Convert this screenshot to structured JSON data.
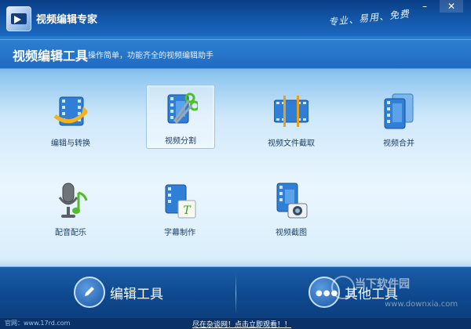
{
  "window": {
    "app_title": "视频编辑专家",
    "slogan": "专业、易用、免费",
    "min_glyph": "–",
    "close_glyph": "✕"
  },
  "header": {
    "title": "视频编辑工具",
    "description": "操作简单，功能齐全的视频编辑助手"
  },
  "tools": [
    {
      "label": "编辑与转换",
      "icon": "film-convert-icon"
    },
    {
      "label": "视频分割",
      "icon": "film-scissors-icon",
      "selected": true
    },
    {
      "label": "视频文件截取",
      "icon": "film-clip-icon"
    },
    {
      "label": "视频合并",
      "icon": "film-merge-icon"
    },
    {
      "label": "配音配乐",
      "icon": "microphone-music-icon"
    },
    {
      "label": "字幕制作",
      "icon": "film-subtitle-icon"
    },
    {
      "label": "视频截图",
      "icon": "film-camera-icon"
    }
  ],
  "bottom": {
    "edit_tools_label": "编辑工具",
    "other_tools_label": "其他工具"
  },
  "status": {
    "site": "官网：www.17rd.com",
    "promo": "尽在杂谈网！点击立即观看！！"
  },
  "watermark": {
    "brand": "当下软件园",
    "url": "www.downxia.com"
  },
  "colors": {
    "accent": "#1e6cc2",
    "film_blue": "#2f7fd6",
    "bottom_bar": "#0f4a90"
  }
}
